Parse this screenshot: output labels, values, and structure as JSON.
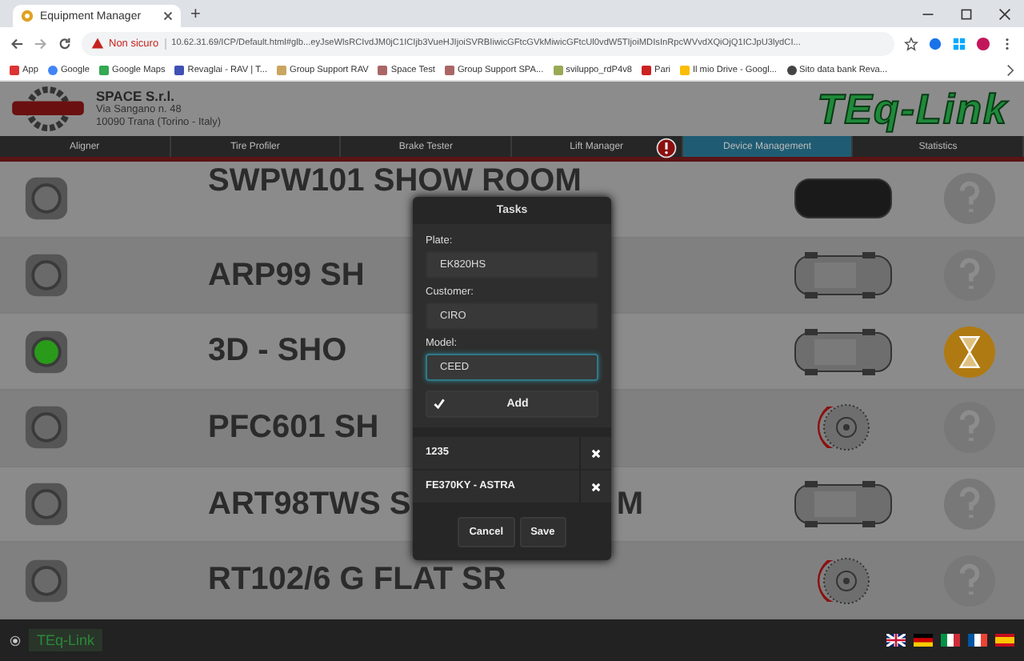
{
  "browser": {
    "tab_title": "Equipment Manager",
    "new_tab": "+",
    "security": "Non sicuro",
    "url": "10.62.31.69/ICP/Default.html#glb...eyJseWlsRCIvdJM0jC1ICIjb3VueHJIjoiSVRBIiwicGFtcGVkMiwicGFtcUl0vdW5TIjoiMDIsInRpcWVvdXQiOjQ1ICJpU3lydCI...",
    "bookmarks": [
      {
        "kind": "apps",
        "label": "App"
      },
      {
        "kind": "google",
        "label": "Google"
      },
      {
        "kind": "maps",
        "label": "Google Maps"
      },
      {
        "kind": "doc",
        "label": "Revaglai - RAV | T..."
      },
      {
        "kind": "folder",
        "label": "Group Support RAV"
      },
      {
        "kind": "plane",
        "label": "Space Test"
      },
      {
        "kind": "plane",
        "label": "Group Support SPA..."
      },
      {
        "kind": "dev",
        "label": "sviluppo_rdP4v8"
      },
      {
        "kind": "red",
        "label": "Pari"
      },
      {
        "kind": "drive",
        "label": "Il mio Drive - Googl..."
      },
      {
        "kind": "globe",
        "label": "Sito data bank Reva..."
      }
    ]
  },
  "header": {
    "company": "SPACE S.r.l.",
    "address_lines": [
      "Via Sangano n. 48",
      "10090 Trana (Torino - Italy)"
    ],
    "brand": "TEq-Link"
  },
  "nav": [
    {
      "label": "Aligner",
      "selected": false,
      "alert": false
    },
    {
      "label": "Tire Profiler",
      "selected": false,
      "alert": false
    },
    {
      "label": "Brake Tester",
      "selected": false,
      "alert": false
    },
    {
      "label": "Lift Manager",
      "selected": false,
      "alert": true
    },
    {
      "label": "Device Management",
      "selected": true,
      "alert": false
    },
    {
      "label": "Statistics",
      "selected": false,
      "alert": false
    }
  ],
  "rows": [
    {
      "name": "SWPW101 SHOW ROOM",
      "lamp_on": false,
      "kind": "car-body",
      "waiting": false
    },
    {
      "name": "ARP99 SH",
      "lamp_on": false,
      "kind": "car",
      "waiting": false
    },
    {
      "name": "3D - SHO",
      "lamp_on": true,
      "kind": "car",
      "waiting": true
    },
    {
      "name": "PFC601 SH",
      "lamp_on": false,
      "kind": "brake",
      "waiting": false
    },
    {
      "name": "ART98TWS S",
      "tail": "M",
      "lamp_on": false,
      "kind": "car",
      "waiting": false
    },
    {
      "name": "RT102/6 G FLAT SR",
      "lamp_on": false,
      "kind": "brake",
      "waiting": false
    }
  ],
  "modal": {
    "title": "Tasks",
    "fields": [
      {
        "label": "Plate:",
        "value": "EK820HS",
        "focused": false
      },
      {
        "label": "Customer:",
        "value": "CIRO",
        "focused": false
      },
      {
        "label": "Model:",
        "value": "CEED",
        "focused": true
      }
    ],
    "add_button": "Add",
    "items": [
      "1235",
      "FE370KY - ASTRA"
    ],
    "buttons": [
      "Cancel",
      "Save"
    ]
  },
  "footer": {
    "brand": "TEq-Link",
    "flags": [
      {
        "kind": "uk"
      },
      {
        "kind": "de"
      },
      {
        "kind": "it"
      },
      {
        "kind": "fr"
      },
      {
        "kind": "es"
      }
    ]
  }
}
